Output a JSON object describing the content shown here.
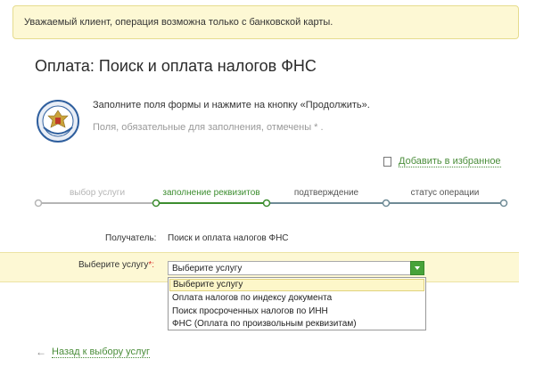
{
  "notice": {
    "text": "Уважаемый клиент, операция возможна только с банковской карты."
  },
  "page": {
    "title": "Оплата: Поиск и оплата налогов ФНС",
    "instruction": "Заполните поля формы и нажмите на кнопку «Продолжить».",
    "required_note": "Поля, обязательные для заполнения, отмечены * ."
  },
  "favorites": {
    "label": "Добавить в избранное",
    "icon": "bookmark-icon"
  },
  "steps": [
    {
      "label": "выбор услуги",
      "state": "done"
    },
    {
      "label": "заполнение реквизитов",
      "state": "active"
    },
    {
      "label": "подтверждение",
      "state": "todo"
    },
    {
      "label": "статус операции",
      "state": "todo"
    }
  ],
  "recipient": {
    "label": "Получатель:",
    "value": "Поиск и оплата налогов ФНС"
  },
  "service": {
    "label": "Выберите услугу",
    "required_mark": "*:",
    "selected": "Выберите услугу",
    "options": [
      "Выберите услугу",
      "Оплата налогов по индексу документа",
      "Поиск просроченных налогов по ИНН",
      "ФНС (Оплата по произвольным реквизитам)"
    ]
  },
  "back_link": {
    "label": "Назад к выбору услуг",
    "icon": "arrow-left-icon"
  },
  "colors": {
    "accent_green": "#3c8d2f",
    "notice_bg": "#fdf8d4",
    "progress_line_done": "#b5b5b5",
    "progress_line_todo": "#6f8b96"
  }
}
